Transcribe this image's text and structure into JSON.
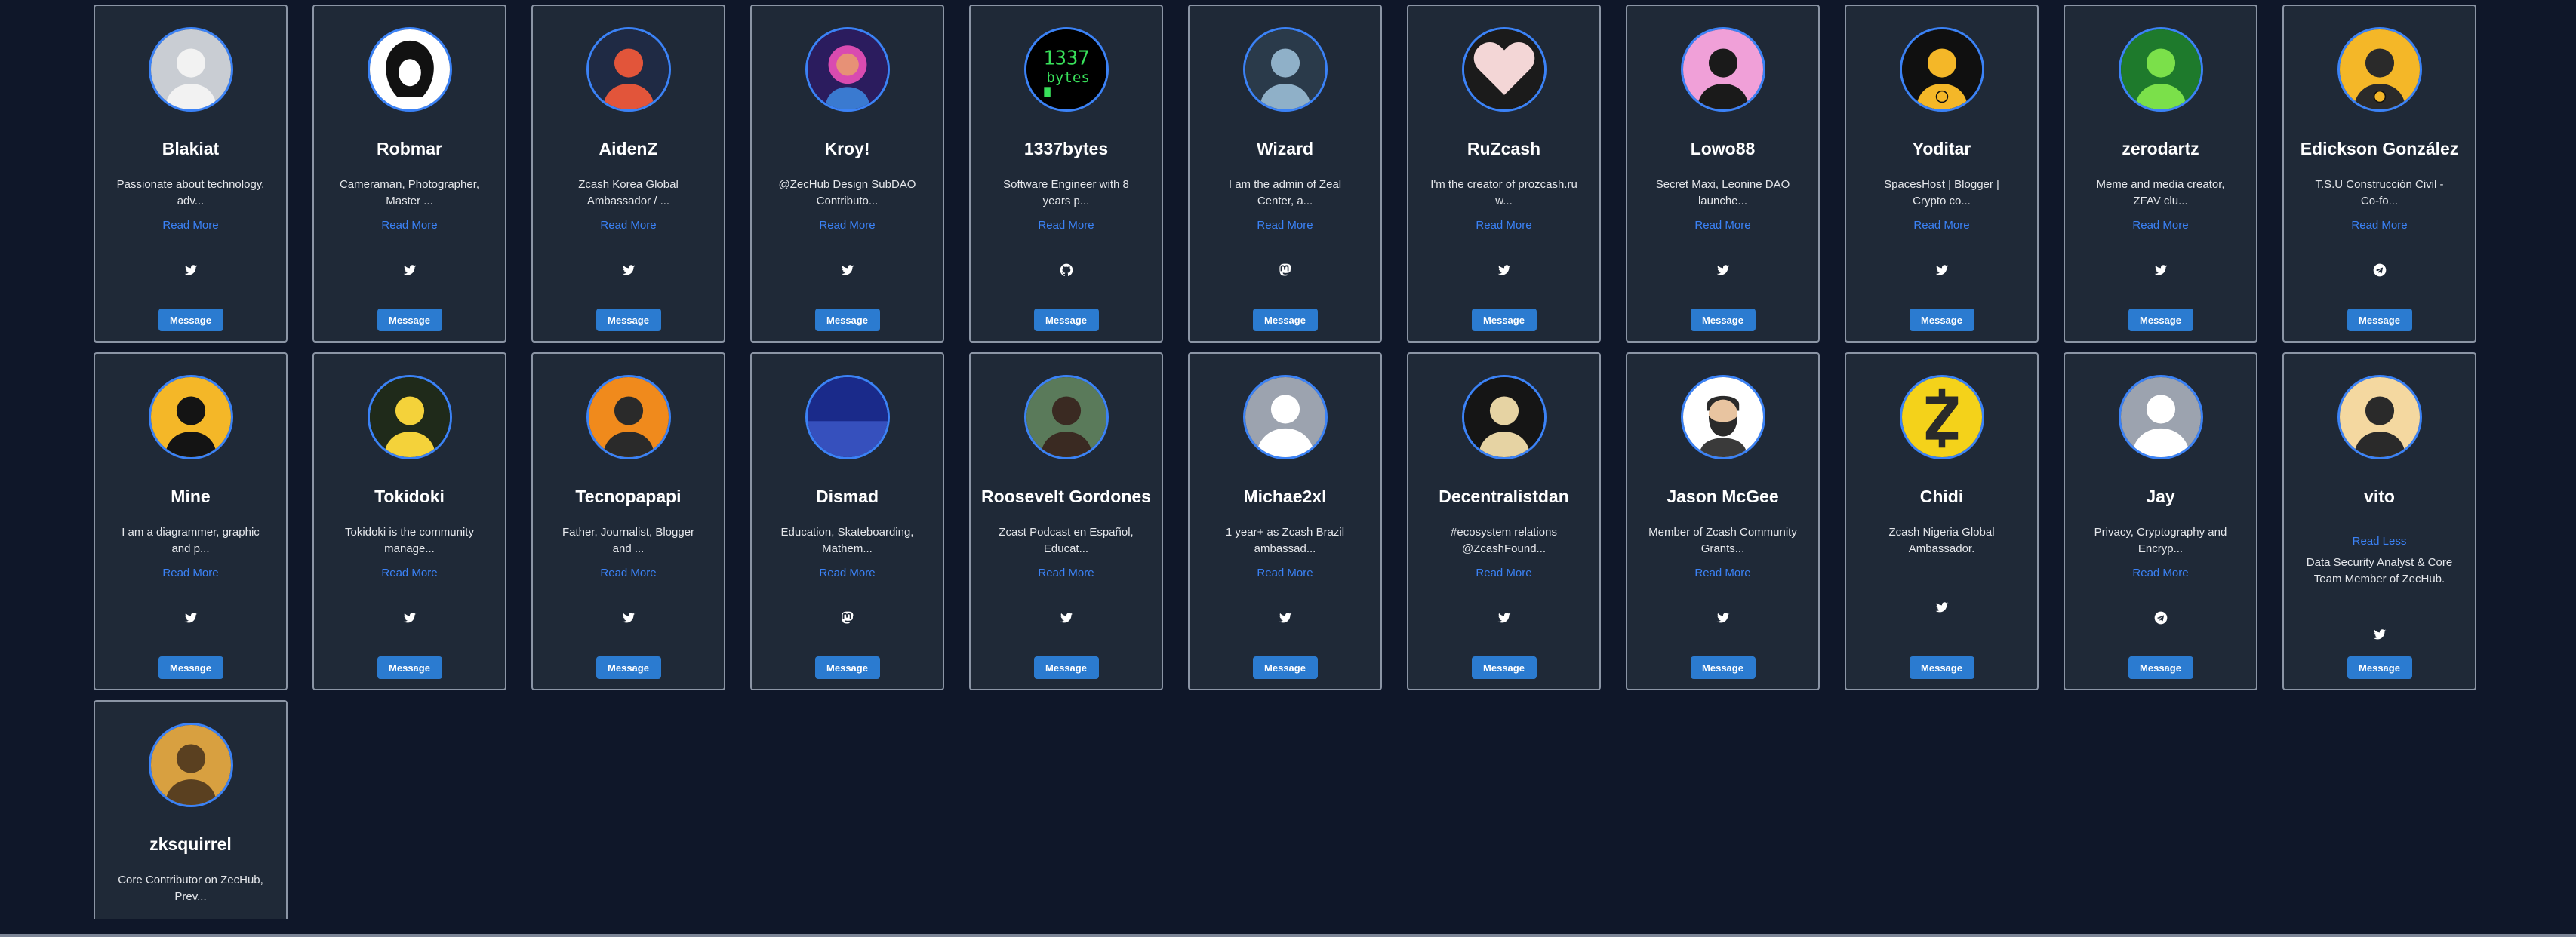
{
  "members": [
    {
      "name": "Blakiat",
      "bio": "Passionate about technology, adv...",
      "link": "Read More",
      "social": "twitter-icon",
      "button": "Message",
      "avatar": {
        "bg": "#c9cdd3",
        "fg": "#f2f2f2",
        "motif": "person-white"
      }
    },
    {
      "name": "Robmar",
      "bio": "Cameraman, Photographer, Master ...",
      "link": "Read More",
      "social": "twitter-icon",
      "button": "Message",
      "avatar": {
        "bg": "#ffffff",
        "fg": "#111111",
        "motif": "hood"
      }
    },
    {
      "name": "AidenZ",
      "bio": "Zcash Korea Global Ambassador / ...",
      "link": "Read More",
      "social": "twitter-icon",
      "button": "Message",
      "avatar": {
        "bg": "#1f2a44",
        "fg": "#e2553a",
        "motif": "person"
      }
    },
    {
      "name": "Kroy!",
      "bio": "@ZecHub Design SubDAO Contributo...",
      "link": "Read More",
      "social": "twitter-icon",
      "button": "Message",
      "avatar": {
        "bg": "#2b1c5e",
        "fg": "#d94bb0",
        "motif": "statue"
      }
    },
    {
      "name": "1337bytes",
      "bio": "Software Engineer with 8 years p...",
      "link": "Read More",
      "social": "github-icon",
      "button": "Message",
      "avatar": {
        "bg": "#000000",
        "fg": "#38e05a",
        "motif": "terminal",
        "text1": "1337",
        "text2": "bytes"
      }
    },
    {
      "name": "Wizard",
      "bio": "I am the admin of Zeal Center, a...",
      "link": "Read More",
      "social": "mastodon-icon",
      "button": "Message",
      "avatar": {
        "bg": "#2a3a4a",
        "fg": "#8fb0c8",
        "motif": "person"
      }
    },
    {
      "name": "RuZcash",
      "bio": "I'm the creator of prozcash.ru w...",
      "link": "Read More",
      "social": "twitter-icon",
      "button": "Message",
      "avatar": {
        "bg": "#1b1b1b",
        "fg": "#f3d6d6",
        "motif": "heart"
      }
    },
    {
      "name": "Lowo88",
      "bio": "Secret Maxi, Leonine DAO launche...",
      "link": "Read More",
      "social": "twitter-icon",
      "button": "Message",
      "avatar": {
        "bg": "#f0a0d8",
        "fg": "#1a1a1a",
        "motif": "person"
      }
    },
    {
      "name": "Yoditar",
      "bio": "SpacesHost | Blogger | Crypto co...",
      "link": "Read More",
      "social": "twitter-icon",
      "button": "Message",
      "avatar": {
        "bg": "#101010",
        "fg": "#f4b728",
        "motif": "zcash-person"
      }
    },
    {
      "name": "zerodartz",
      "bio": "Meme and media creator, ZFAV clu...",
      "link": "Read More",
      "social": "twitter-icon",
      "button": "Message",
      "avatar": {
        "bg": "#1e7a2c",
        "fg": "#7be04a",
        "motif": "person"
      }
    },
    {
      "name": "Edickson González",
      "bio": "T.S.U Construcción Civil - Co-fo...",
      "link": "Read More",
      "social": "telegram-icon",
      "button": "Message",
      "avatar": {
        "bg": "#f4b728",
        "fg": "#2a2a2a",
        "motif": "zcash-person"
      }
    },
    {
      "name": "Mine",
      "bio": "I am a diagrammer, graphic and p...",
      "link": "Read More",
      "social": "twitter-icon",
      "button": "Message",
      "avatar": {
        "bg": "#f4b728",
        "fg": "#141414",
        "motif": "person"
      }
    },
    {
      "name": "Tokidoki",
      "bio": "Tokidoki is the community manage...",
      "link": "Read More",
      "social": "twitter-icon",
      "button": "Message",
      "avatar": {
        "bg": "#1f2a1a",
        "fg": "#f4d23a",
        "motif": "person"
      }
    },
    {
      "name": "Tecnopapapi",
      "bio": "Father, Journalist, Blogger and ...",
      "link": "Read More",
      "social": "twitter-icon",
      "button": "Message",
      "avatar": {
        "bg": "#f08a1c",
        "fg": "#2a2a2a",
        "motif": "person"
      }
    },
    {
      "name": "Dismad",
      "bio": "Education, Skateboarding, Mathem...",
      "link": "Read More",
      "social": "mastodon-icon",
      "button": "Message",
      "avatar": {
        "bg": "#1a2a8a",
        "fg": "#4a6ae0",
        "motif": "gradient"
      }
    },
    {
      "name": "Roosevelt Gordones",
      "bio": "Zcast Podcast en Español, Educat...",
      "link": "Read More",
      "social": "twitter-icon",
      "button": "Message",
      "avatar": {
        "bg": "#5a7a5a",
        "fg": "#3a2a22",
        "motif": "person"
      }
    },
    {
      "name": "Michae2xl",
      "bio": "1 year+ as Zcash Brazil ambassad...",
      "link": "Read More",
      "social": "twitter-icon",
      "button": "Message",
      "avatar": {
        "bg": "#9ca3af",
        "fg": "#ffffff",
        "motif": "placeholder"
      }
    },
    {
      "name": "Decentralistdan",
      "bio": "#ecosystem relations @ZcashFound...",
      "link": "Read More",
      "social": "twitter-icon",
      "button": "Message",
      "avatar": {
        "bg": "#151515",
        "fg": "#e6d3a3",
        "motif": "person"
      }
    },
    {
      "name": "Jason McGee",
      "bio": "Member of Zcash Community Grants...",
      "link": "Read More",
      "social": "twitter-icon",
      "button": "Message",
      "avatar": {
        "bg": "#ffffff",
        "fg": "#2a2a2a",
        "motif": "bearded"
      }
    },
    {
      "name": "Chidi",
      "bio": "Zcash Nigeria Global Ambassador.",
      "link": "",
      "social": "twitter-icon",
      "button": "Message",
      "avatar": {
        "bg": "#f4d21a",
        "fg": "#2a2a2a",
        "motif": "zcash"
      },
      "variant": "b"
    },
    {
      "name": "Jay",
      "bio": "Privacy, Cryptography and Encryp...",
      "link": "Read More",
      "social": "telegram-icon",
      "button": "Message",
      "avatar": {
        "bg": "#9ca3af",
        "fg": "#ffffff",
        "motif": "placeholder"
      }
    },
    {
      "name": "vito",
      "bio": "Data Security Analyst & Core Team Member of ZecHub.",
      "link": "Read Less",
      "social": "twitter-icon",
      "button": "Message",
      "avatar": {
        "bg": "#f4d8a0",
        "fg": "#2a2a2a",
        "motif": "person"
      },
      "variant": "c"
    },
    {
      "name": "zksquirrel",
      "bio": "Core Contributor on ZecHub, Prev...",
      "link": "",
      "social": "",
      "button": "",
      "avatar": {
        "bg": "#d8a040",
        "fg": "#5a4020",
        "motif": "person"
      },
      "partial": true
    }
  ]
}
